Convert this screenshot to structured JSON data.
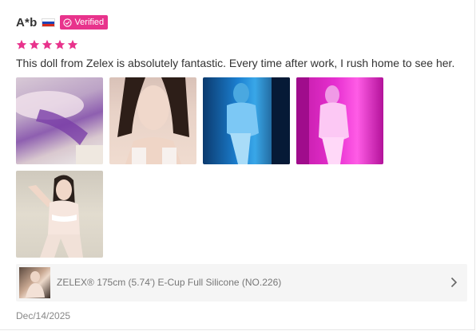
{
  "review": {
    "author": "A*b",
    "country_flag": "russia-flag-icon",
    "verified_label": "Verified",
    "rating": 5,
    "rating_max": 5,
    "text": "This doll from Zelex is absolutely fantastic. Every time after work, I rush home to see her.",
    "date": "Dec/14/2025"
  },
  "product": {
    "name": "ZELEX® 175cm (5.74') E-Cup Full Silicone (NO.226)"
  },
  "colors": {
    "accent": "#e8338c",
    "star": "#e8338c",
    "product_bg": "#f5f5f5"
  }
}
